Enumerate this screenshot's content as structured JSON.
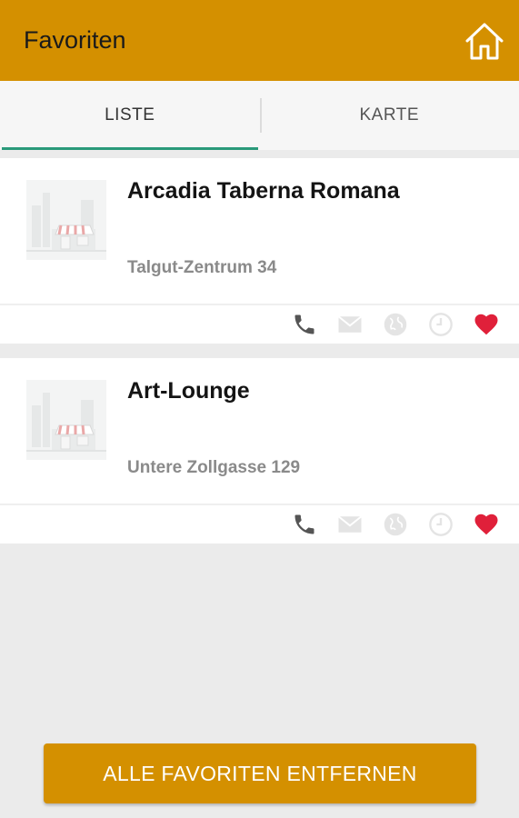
{
  "appbar": {
    "title": "Favoriten",
    "home_icon": "home-icon"
  },
  "tabs": [
    {
      "label": "LISTE",
      "active": true
    },
    {
      "label": "KARTE",
      "active": false
    }
  ],
  "favorites": [
    {
      "name": "Arcadia Taberna Romana",
      "address": "Talgut-Zentrum 34"
    },
    {
      "name": "Art-Lounge",
      "address": "Untere Zollgasse 129"
    }
  ],
  "actions": [
    "phone-icon",
    "mail-icon",
    "globe-icon",
    "clock-icon",
    "heart-icon"
  ],
  "colors": {
    "brand": "#d49000",
    "tab_indicator": "#2a9a7a",
    "heart": "#e0203a",
    "phone": "#555555",
    "inactive_icon": "#e3e3e3"
  },
  "footer": {
    "remove_all_label": "ALLE FAVORITEN ENTFERNEN"
  }
}
